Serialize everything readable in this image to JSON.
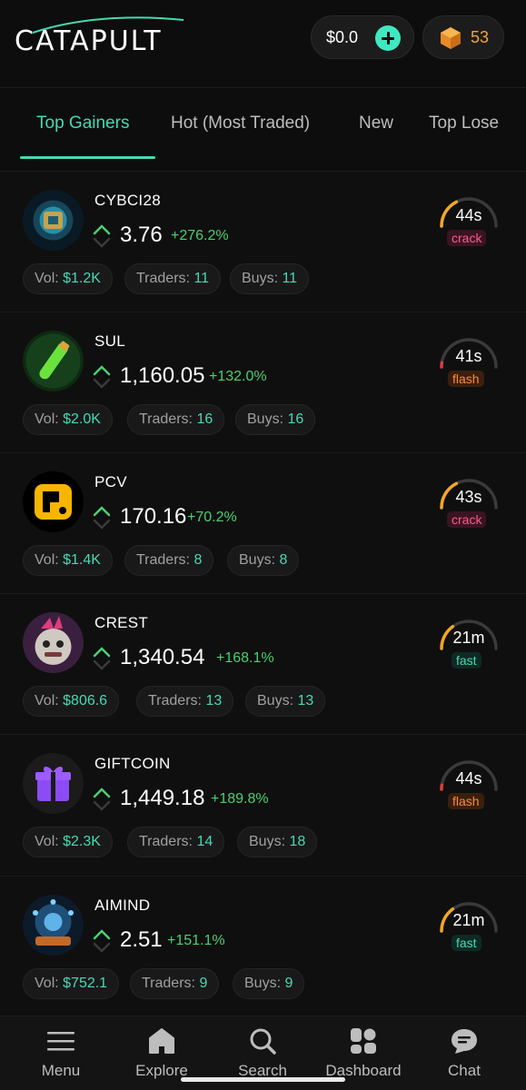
{
  "header": {
    "logo_text": "CATAPULT",
    "balance": "$0.0",
    "gems": "53"
  },
  "tabs": [
    {
      "label": "Top Gainers",
      "active": true
    },
    {
      "label": "Hot (Most Traded)",
      "active": false
    },
    {
      "label": "New",
      "active": false
    },
    {
      "label": "Top Lose",
      "active": false
    }
  ],
  "chip_labels": {
    "vol": "Vol:",
    "traders": "Traders:",
    "buys": "Buys:"
  },
  "tokens": [
    {
      "name": "CYBCI28",
      "price": "3.76",
      "change": "+276.2%",
      "vol": "$1.2K",
      "traders": "11",
      "buys": "11",
      "time": "44s",
      "tag": "crack",
      "progress": 0.35
    },
    {
      "name": "SUL",
      "price": "1,160.05",
      "change": "+132.0%",
      "vol": "$2.0K",
      "traders": "16",
      "buys": "16",
      "time": "41s",
      "tag": "flash",
      "progress": 0.05
    },
    {
      "name": "PCV",
      "price": "170.16",
      "change": "+70.2%",
      "vol": "$1.4K",
      "traders": "8",
      "buys": "8",
      "time": "43s",
      "tag": "crack",
      "progress": 0.35
    },
    {
      "name": "CREST",
      "price": "1,340.54",
      "change": "+168.1%",
      "vol": "$806.6",
      "traders": "13",
      "buys": "13",
      "time": "21m",
      "tag": "fast",
      "progress": 0.3
    },
    {
      "name": "GIFTCOIN",
      "price": "1,449.18",
      "change": "+189.8%",
      "vol": "$2.3K",
      "traders": "14",
      "buys": "18",
      "time": "44s",
      "tag": "flash",
      "progress": 0.05
    },
    {
      "name": "AIMIND",
      "price": "2.51",
      "change": "+151.1%",
      "vol": "$752.1",
      "traders": "9",
      "buys": "9",
      "time": "21m",
      "tag": "fast",
      "progress": 0.3
    }
  ],
  "nav": [
    {
      "label": "Menu",
      "icon": "menu-icon"
    },
    {
      "label": "Explore",
      "icon": "home-icon"
    },
    {
      "label": "Search",
      "icon": "search-icon"
    },
    {
      "label": "Dashboard",
      "icon": "dashboard-icon"
    },
    {
      "label": "Chat",
      "icon": "chat-icon"
    }
  ],
  "colors": {
    "accent": "#46d9b4",
    "positive": "#4ccf71",
    "gauge_fill": "#f5a623",
    "gauge_red": "#e03a3a",
    "gem": "#f2a33c"
  }
}
